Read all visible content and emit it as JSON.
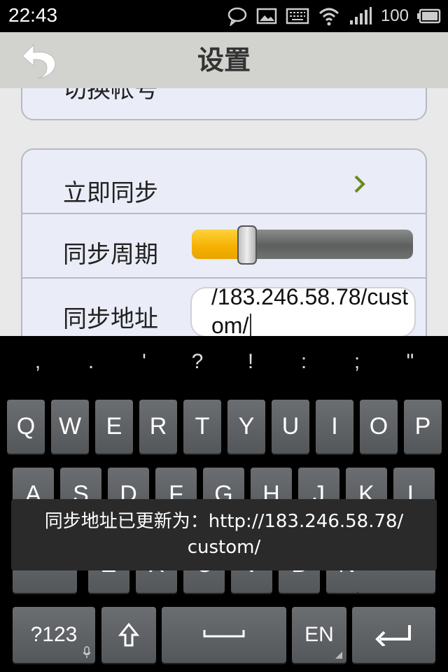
{
  "status_bar": {
    "time": "22:43",
    "battery": "100",
    "icons": [
      "chat-bubble-icon",
      "image-icon",
      "keyboard-icon",
      "wifi-icon",
      "signal-icon",
      "battery-icon"
    ]
  },
  "header": {
    "title": "设置",
    "back_icon": "back-arrow-icon"
  },
  "settings": {
    "account_label": "切换帐号",
    "sync_now_label": "立即同步",
    "sync_period_label": "同步周期",
    "sync_period_level": 0.25,
    "sync_address_label": "同步地址",
    "sync_address_value": "/183.246.58.78/custom/"
  },
  "keyboard": {
    "punctuation": [
      ",",
      ".",
      "'",
      "?",
      "!",
      ":",
      ";",
      "\""
    ],
    "row1": [
      "Q",
      "W",
      "E",
      "R",
      "T",
      "Y",
      "U",
      "I",
      "O",
      "P"
    ],
    "row2": [
      "A",
      "S",
      "D",
      "F",
      "G",
      "H",
      "J",
      "K",
      "L"
    ],
    "row3": [
      "Z",
      "X",
      "C",
      "V",
      "B",
      "N",
      "M"
    ],
    "symbols_label": "?123",
    "lang_label": "EN"
  },
  "toast": {
    "line1": "同步地址已更新为：http://183.246.58.78/",
    "line2": "custom/"
  },
  "colors": {
    "accent": "#f5b000",
    "chevron": "#6a8a18"
  }
}
